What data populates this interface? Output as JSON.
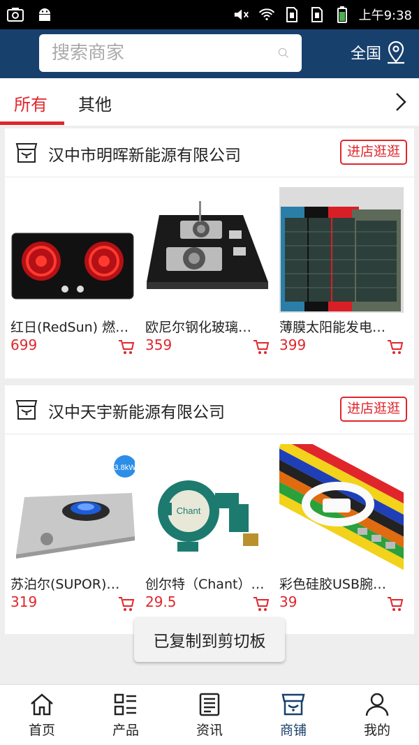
{
  "status_bar": {
    "time": "上午9:38",
    "left_icons": [
      "screenshot-icon",
      "android-icon"
    ],
    "right_icons": [
      "mute-icon",
      "wifi-icon",
      "sim1-icon",
      "sim2-icon",
      "battery-icon"
    ]
  },
  "header": {
    "search_placeholder": "搜索商家",
    "region_label": "全国"
  },
  "tabs": {
    "items": [
      {
        "label": "所有",
        "active": true
      },
      {
        "label": "其他",
        "active": false
      }
    ]
  },
  "stores": [
    {
      "name": "汉中市明晖新能源有限公司",
      "visit_label": "进店逛逛",
      "products": [
        {
          "name": "红日(RedSun) 燃…",
          "price": "699"
        },
        {
          "name": "欧尼尔钢化玻璃…",
          "price": "359"
        },
        {
          "name": "薄膜太阳能发电…",
          "price": "399"
        }
      ]
    },
    {
      "name": "汉中天宇新能源有限公司",
      "visit_label": "进店逛逛",
      "products": [
        {
          "name": "苏泊尔(SUPOR)…",
          "price": "319",
          "badge": "3.8kW"
        },
        {
          "name": "创尔特（Chant）…",
          "price": "29.5",
          "badge": "Chant"
        },
        {
          "name": "彩色硅胶USB腕…",
          "price": "39"
        }
      ]
    }
  ],
  "toast": "已复制到剪切板",
  "bottom_nav": [
    {
      "label": "首页",
      "icon": "home-icon"
    },
    {
      "label": "产品",
      "icon": "product-list-icon"
    },
    {
      "label": "资讯",
      "icon": "news-icon"
    },
    {
      "label": "商铺",
      "icon": "store-icon",
      "active": true
    },
    {
      "label": "我的",
      "icon": "profile-icon"
    }
  ],
  "colors": {
    "header_bg": "#17406d",
    "accent_red": "#e0262b",
    "active_nav": "#17406d"
  }
}
